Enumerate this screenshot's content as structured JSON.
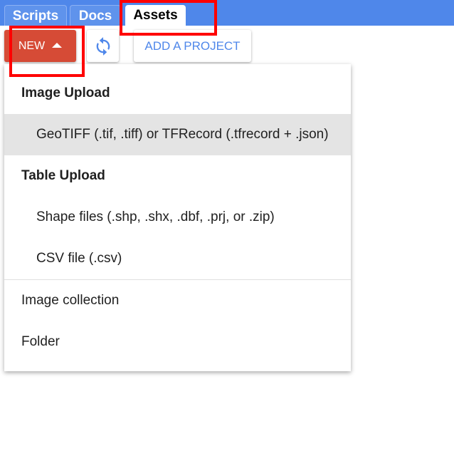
{
  "tabs": [
    {
      "label": "Scripts",
      "active": false
    },
    {
      "label": "Docs",
      "active": false
    },
    {
      "label": "Assets",
      "active": true
    }
  ],
  "toolbar": {
    "new_label": "NEW",
    "refresh_icon": "refresh-icon",
    "add_project_label": "ADD A PROJECT"
  },
  "menu": {
    "image_upload_header": "Image Upload",
    "geotiff_item": "GeoTIFF (.tif, .tiff) or TFRecord (.tfrecord + .json)",
    "table_upload_header": "Table Upload",
    "shape_files_item": "Shape files (.shp, .shx, .dbf, .prj, or .zip)",
    "csv_item": "CSV file (.csv)",
    "image_collection_item": "Image collection",
    "folder_item": "Folder"
  },
  "colors": {
    "tab_bar": "#4f87ea",
    "new_button": "#d64b36",
    "accent_blue": "#4f87ea",
    "highlight": "#e4e4e4",
    "annotation": "#ff0000"
  }
}
